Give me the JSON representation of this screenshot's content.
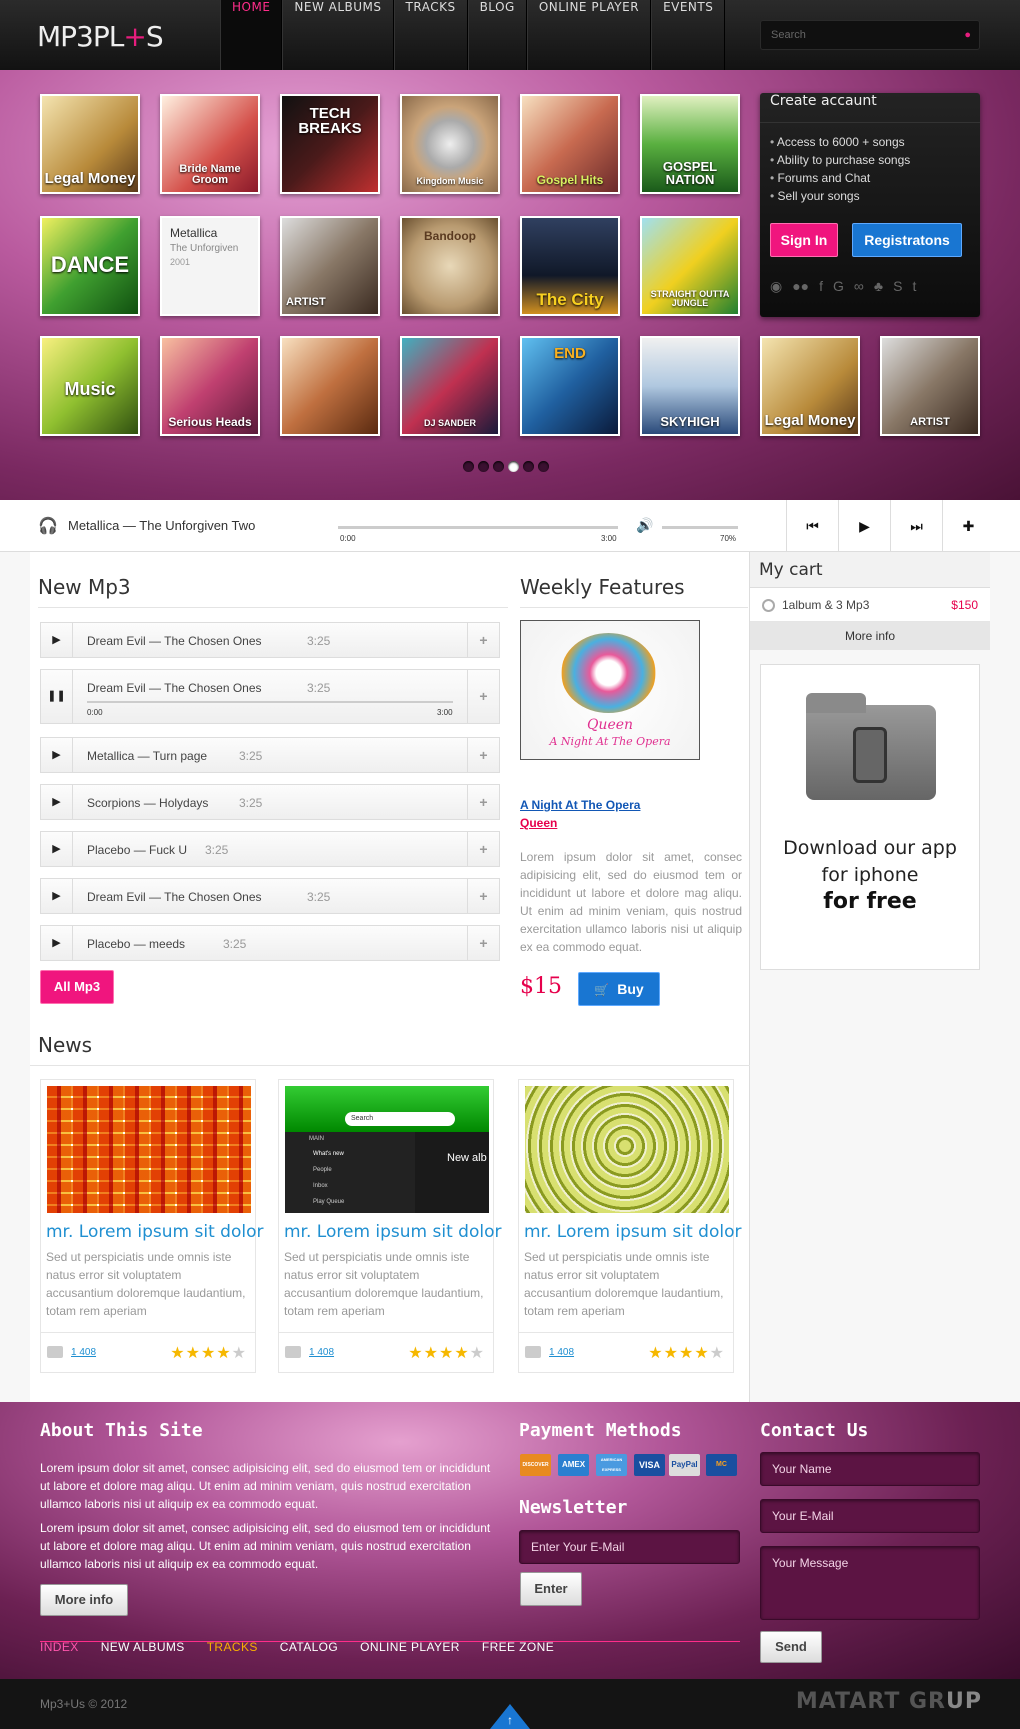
{
  "header": {
    "logo_left": "MP3PL",
    "logo_plus": "+",
    "logo_right": "S",
    "nav": [
      "HOME",
      "NEW ALBUMS",
      "TRACKS",
      "BLOG",
      "ONLINE PLAYER",
      "EVENTS"
    ],
    "active_nav": "HOME",
    "search_placeholder": "Search",
    "brand_color": "#e61d7d"
  },
  "hero": {
    "covers": [
      {
        "label": "Legal Money"
      },
      {
        "label": "Bride Name Groom"
      },
      {
        "label": "TECH BREAKS"
      },
      {
        "label": "Kingdom Music"
      },
      {
        "label": "Gospel Hits"
      },
      {
        "label": "GOSPEL NATION"
      },
      {
        "label": "DANCE"
      },
      {
        "label": ""
      },
      {
        "label": "ARTIST"
      },
      {
        "label": "Bandoop"
      },
      {
        "label": "The City"
      },
      {
        "label": "STRAIGHT OUTTA JUNGLE"
      },
      {
        "label": "Music"
      },
      {
        "label": "Serious Heads"
      },
      {
        "label": ""
      },
      {
        "label": "DJ SANDER"
      },
      {
        "label": "END"
      },
      {
        "label": "SKYHIGH"
      },
      {
        "label": "Legal Money"
      },
      {
        "label": "ARTIST"
      }
    ],
    "info_card": {
      "title": "Metallica",
      "subtitle": "The Unforgiven",
      "year": "2001"
    },
    "account": {
      "title": "Create accaunt",
      "items": [
        "Access to 6000 + songs",
        "Ability to purchase songs",
        "Forums and Chat",
        "Sell your songs"
      ],
      "signin": "Sign In",
      "register": "Registratons"
    },
    "slider_pages": 6,
    "slider_active": 4
  },
  "player": {
    "song": "Metallica — The  Unforgiven Two",
    "time_start": "0:00",
    "time_end": "3:00",
    "volume": "70%"
  },
  "new_mp3": {
    "title": "New Mp3",
    "tracks": [
      {
        "name": "Dream Evil — The Chosen Ones",
        "dur": "3:25",
        "state": "play"
      },
      {
        "name": "Dream Evil — The Chosen Ones",
        "dur": "3:25",
        "state": "pause",
        "t0": "0:00",
        "t1": "3:00"
      },
      {
        "name": "Metallica — Turn page",
        "dur": "3:25",
        "state": "play"
      },
      {
        "name": "Scorpions — Holydays",
        "dur": "3:25",
        "state": "play"
      },
      {
        "name": "Placebo — Fuck U",
        "dur": "3:25",
        "state": "play"
      },
      {
        "name": "Dream Evil — The Chosen Ones",
        "dur": "3:25",
        "state": "play"
      },
      {
        "name": "Placebo — meeds",
        "dur": "3:25",
        "state": "play"
      }
    ],
    "all_button": "All Mp3"
  },
  "weekly": {
    "title": "Weekly Features",
    "album_art_title": "Queen",
    "album_art_subtitle": "A Night At The Opera",
    "album": "A Night At The Opera",
    "artist": "Queen",
    "desc": "Lorem ipsum dolor sit amet, consec adipisicing elit, sed do eiusmod tem or incididunt ut labore et dolore mag aliqu. Ut enim ad minim veniam, quis nostrud exercitation ullamco laboris nisi ut aliquip ex ea commodo equat.",
    "price": "$15",
    "buy": "Buy"
  },
  "news": {
    "title": "News",
    "items": [
      {
        "title": "mr. Lorem ipsum sit dolor",
        "desc": "Sed ut perspiciatis unde omnis iste natus error sit voluptatem accusantium doloremque laudantium, totam rem aperiam",
        "comments": "1 408",
        "rating": 4
      },
      {
        "title": "mr. Lorem ipsum sit dolor",
        "desc": "Sed ut perspiciatis unde omnis iste natus error sit voluptatem accusantium doloremque laudantium, totam rem aperiam",
        "comments": "1 408",
        "rating": 4
      },
      {
        "title": "mr. Lorem ipsum sit dolor",
        "desc": "Sed ut perspiciatis unde omnis iste natus error sit voluptatem accusantium doloremque laudantium, totam rem aperiam",
        "comments": "1 408",
        "rating": 4
      }
    ],
    "app_ui": {
      "search": "Search",
      "main": "MAIN",
      "menu": [
        "What's new",
        "People",
        "Inbox",
        "Play Queue"
      ],
      "banner": "New alb"
    }
  },
  "cart": {
    "title": "My cart",
    "item": "1album & 3 Mp3",
    "price": "$150",
    "more": "More info"
  },
  "app_promo": {
    "line1": "Download our app",
    "line2": "for iphone",
    "line3": "for free"
  },
  "footer": {
    "about_title": "About This Site",
    "about_p1": "Lorem ipsum dolor sit amet, consec adipisicing elit, sed do eiusmod tem or incididunt ut labore et dolore mag aliqu. Ut enim ad minim veniam, quis nostrud exercitation ullamco laboris nisi ut aliquip ex ea commodo equat.",
    "about_p2": "Lorem ipsum dolor sit amet, consec adipisicing elit, sed do eiusmod tem or incididunt ut labore et dolore mag aliqu. Ut enim ad minim veniam, quis nostrud exercitation ullamco laboris nisi ut aliquip ex ea commodo equat.",
    "more": "More info",
    "payment_title": "Payment Methods",
    "payments": [
      "DISCOVER",
      "AMEX",
      "AMERICAN EXPRESS",
      "VISA",
      "PayPal",
      "MC"
    ],
    "newsletter_title": "Newsletter",
    "newsletter_placeholder": "Enter Your E-Mail",
    "enter": "Enter",
    "contact_title": "Contact Us",
    "name_placeholder": "Your Name",
    "email_placeholder": "Your E-Mail",
    "message_placeholder": "Your Message",
    "send": "Send",
    "nav": [
      "INDEX",
      "NEW ALBUMS",
      "TRACKS",
      "CATALOG",
      "ONLINE PLAYER",
      "FREE ZONE"
    ],
    "copyright": "Mp3+Us © 2012",
    "brand": "MATART GR",
    "brand_end": "UP"
  }
}
